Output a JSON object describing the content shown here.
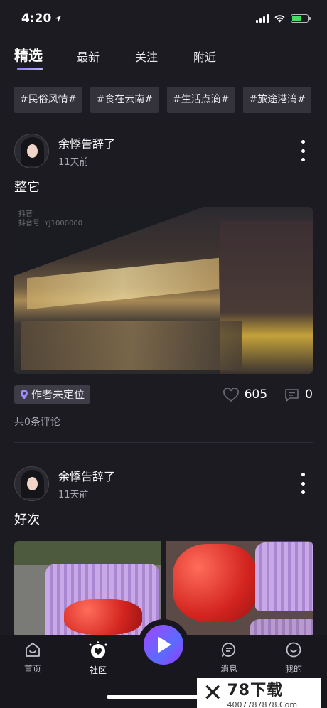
{
  "status_bar": {
    "time": "4:20"
  },
  "tabs": [
    {
      "label": "精选",
      "active": true
    },
    {
      "label": "最新",
      "active": false
    },
    {
      "label": "关注",
      "active": false
    },
    {
      "label": "附近",
      "active": false
    }
  ],
  "topics": [
    "#民俗风情#",
    "#食在云南#",
    "#生活点滴#",
    "#旅途港湾#"
  ],
  "posts": [
    {
      "username": "余悸告辞了",
      "time": "11天前",
      "text": "整它",
      "watermark_line1": "抖音",
      "watermark_line2": "抖音号: YJ1000000",
      "location": "作者未定位",
      "likes": "605",
      "comments": "0",
      "comment_summary": "共0条评论"
    },
    {
      "username": "余悸告辞了",
      "time": "11天前",
      "text": "好次"
    }
  ],
  "tabbar": {
    "home": "首页",
    "community": "社区",
    "messages": "消息",
    "mine": "我的"
  },
  "brand": {
    "name": "78下载",
    "phone": "4007787878.Com"
  },
  "colors": {
    "accent": "#8a7cff",
    "background": "#1c1b22",
    "play_gradient_start": "#a545ff",
    "play_gradient_end": "#5b6bff"
  }
}
